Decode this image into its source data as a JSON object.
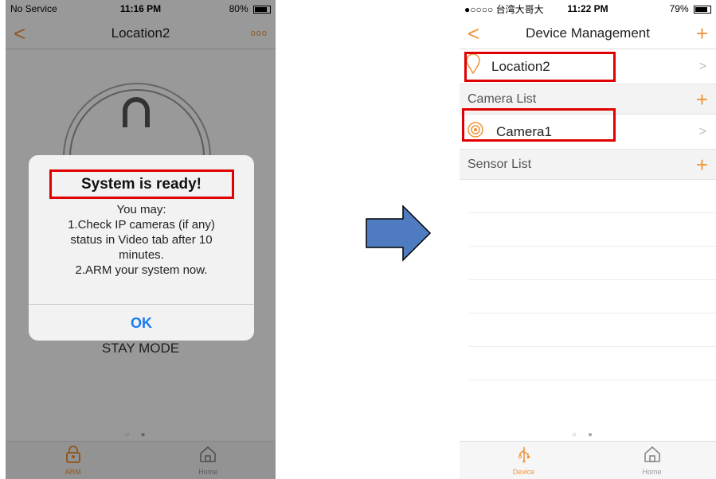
{
  "left_phone": {
    "status": {
      "carrier": "No Service",
      "time": "11:16 PM",
      "battery": "80%",
      "battery_level": 0.8
    },
    "nav": {
      "title": "Location2",
      "more": "ooo"
    },
    "stay_mode": "STAY MODE",
    "alert": {
      "title": "System is ready!",
      "lines": [
        "You may:",
        "1.Check IP cameras (if any)",
        "status in Video tab after 10",
        "minutes.",
        "2.ARM your system now."
      ],
      "ok": "OK"
    },
    "tabs": [
      {
        "label": "ARM"
      },
      {
        "label": "Home"
      }
    ]
  },
  "right_phone": {
    "status": {
      "carrier": "●○○○○ 台湾大哥大",
      "time": "11:22 PM",
      "battery": "79%",
      "battery_level": 0.79
    },
    "nav": {
      "title": "Device Management"
    },
    "location_row": {
      "label": "Location2"
    },
    "camera_section": {
      "label": "Camera List"
    },
    "camera_row": {
      "label": "Camera1"
    },
    "sensor_section": {
      "label": "Sensor List"
    },
    "tabs": [
      {
        "label": "Device"
      },
      {
        "label": "Home"
      }
    ]
  },
  "colors": {
    "accent": "#f0943a",
    "highlight": "#e00000",
    "link": "#1a7cf0",
    "arrow_fill": "#4f7cc0"
  }
}
